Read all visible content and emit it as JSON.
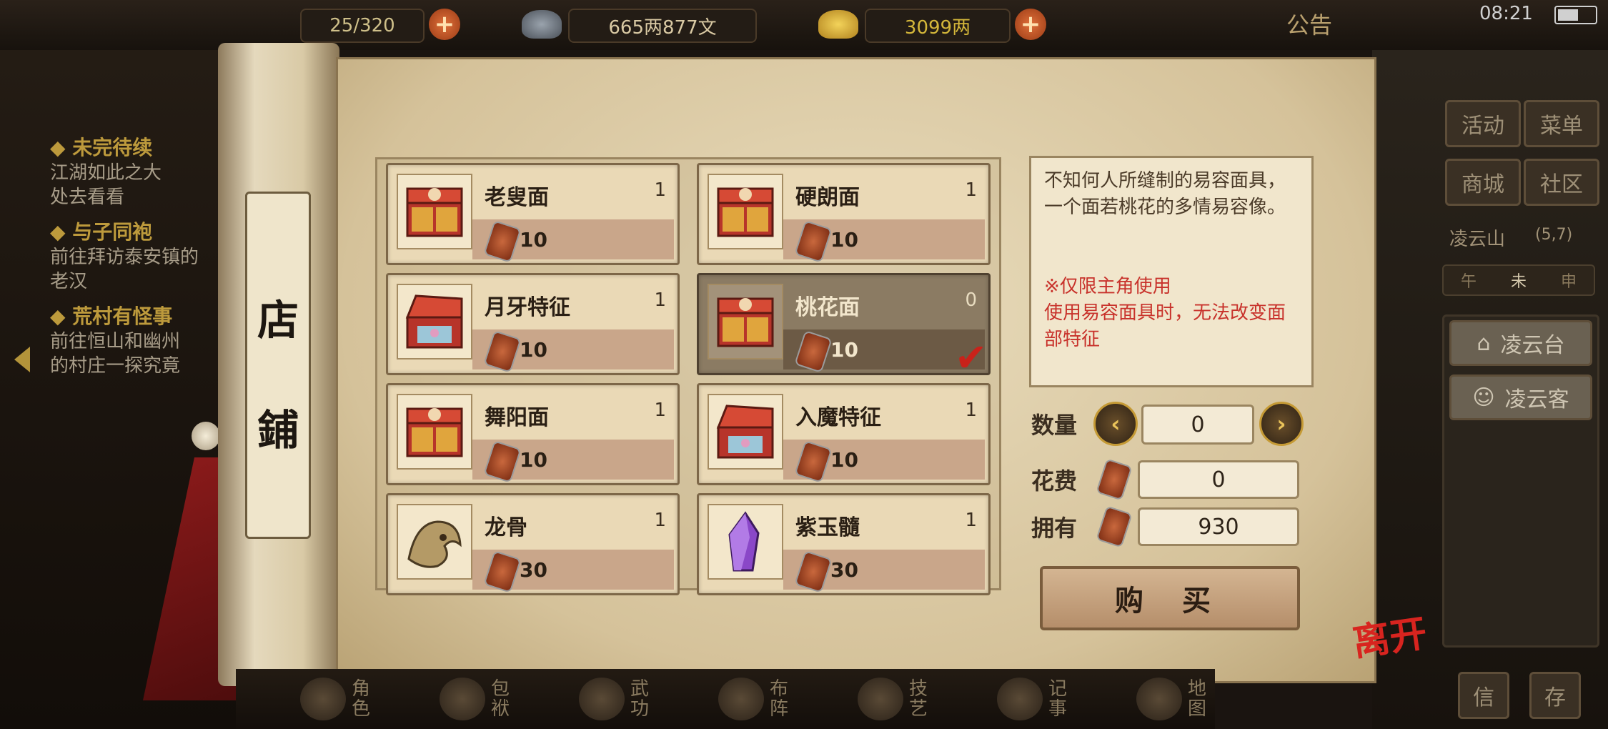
{
  "top_bar": {
    "stamina": "25/320",
    "copper": "665两877文",
    "silver": "3099两",
    "notice_label": "公告",
    "time": "08:21"
  },
  "quests": [
    {
      "title": "未完待续",
      "desc": [
        "江湖如此之大",
        "处去看看"
      ]
    },
    {
      "title": "与子同袍",
      "desc": [
        "前往拜访泰安镇的",
        "老汉"
      ]
    },
    {
      "title": "荒村有怪事",
      "desc": [
        "前往恒山和幽州",
        "的村庄一探究竟"
      ]
    }
  ],
  "shop": {
    "title_chars": [
      "店",
      "鋪"
    ],
    "items": [
      {
        "name": "老叟面",
        "qty": "1",
        "price": "10",
        "icon": "mask-chest-icon",
        "selected": false
      },
      {
        "name": "硬朗面",
        "qty": "1",
        "price": "10",
        "icon": "mask-chest-icon",
        "selected": false
      },
      {
        "name": "月牙特征",
        "qty": "1",
        "price": "10",
        "icon": "feature-chest-open-icon",
        "selected": false
      },
      {
        "name": "桃花面",
        "qty": "0",
        "price": "10",
        "icon": "mask-chest-icon",
        "selected": true
      },
      {
        "name": "舞阳面",
        "qty": "1",
        "price": "10",
        "icon": "mask-chest-icon",
        "selected": false
      },
      {
        "name": "入魔特征",
        "qty": "1",
        "price": "10",
        "icon": "feature-chest-open-icon",
        "selected": false
      },
      {
        "name": "龙骨",
        "qty": "1",
        "price": "30",
        "icon": "dragon-bone-icon",
        "selected": false
      },
      {
        "name": "紫玉髓",
        "qty": "1",
        "price": "30",
        "icon": "purple-crystal-icon",
        "selected": false
      }
    ],
    "description": "不知何人所缝制的易容面具，一个面若桃花的多情易容像。",
    "note": "※仅限主角使用\n使用易容面具时，无法改变面部特征",
    "quantity_label": "数量",
    "quantity_value": "0",
    "cost_label": "花费",
    "cost_value": "0",
    "owned_label": "拥有",
    "owned_value": "930",
    "buy_label": "购 买",
    "leave_label": "离开"
  },
  "side": {
    "activity": "活动",
    "menu": "菜单",
    "mall": "商城",
    "community": "社区",
    "location": "凌云山",
    "coords": "(5,7)",
    "time_marks": [
      "午",
      "未",
      "申"
    ],
    "places": [
      "凌云台",
      "凌云客"
    ],
    "bottom_right": [
      "信",
      "存"
    ]
  },
  "bottom_nav": [
    "角色",
    "包袱",
    "武功",
    "布阵",
    "技艺",
    "记事",
    "地图"
  ],
  "colors": {
    "accent_red": "#c8322b",
    "gold": "#d4b73a",
    "parchment": "#e9dcbc"
  }
}
